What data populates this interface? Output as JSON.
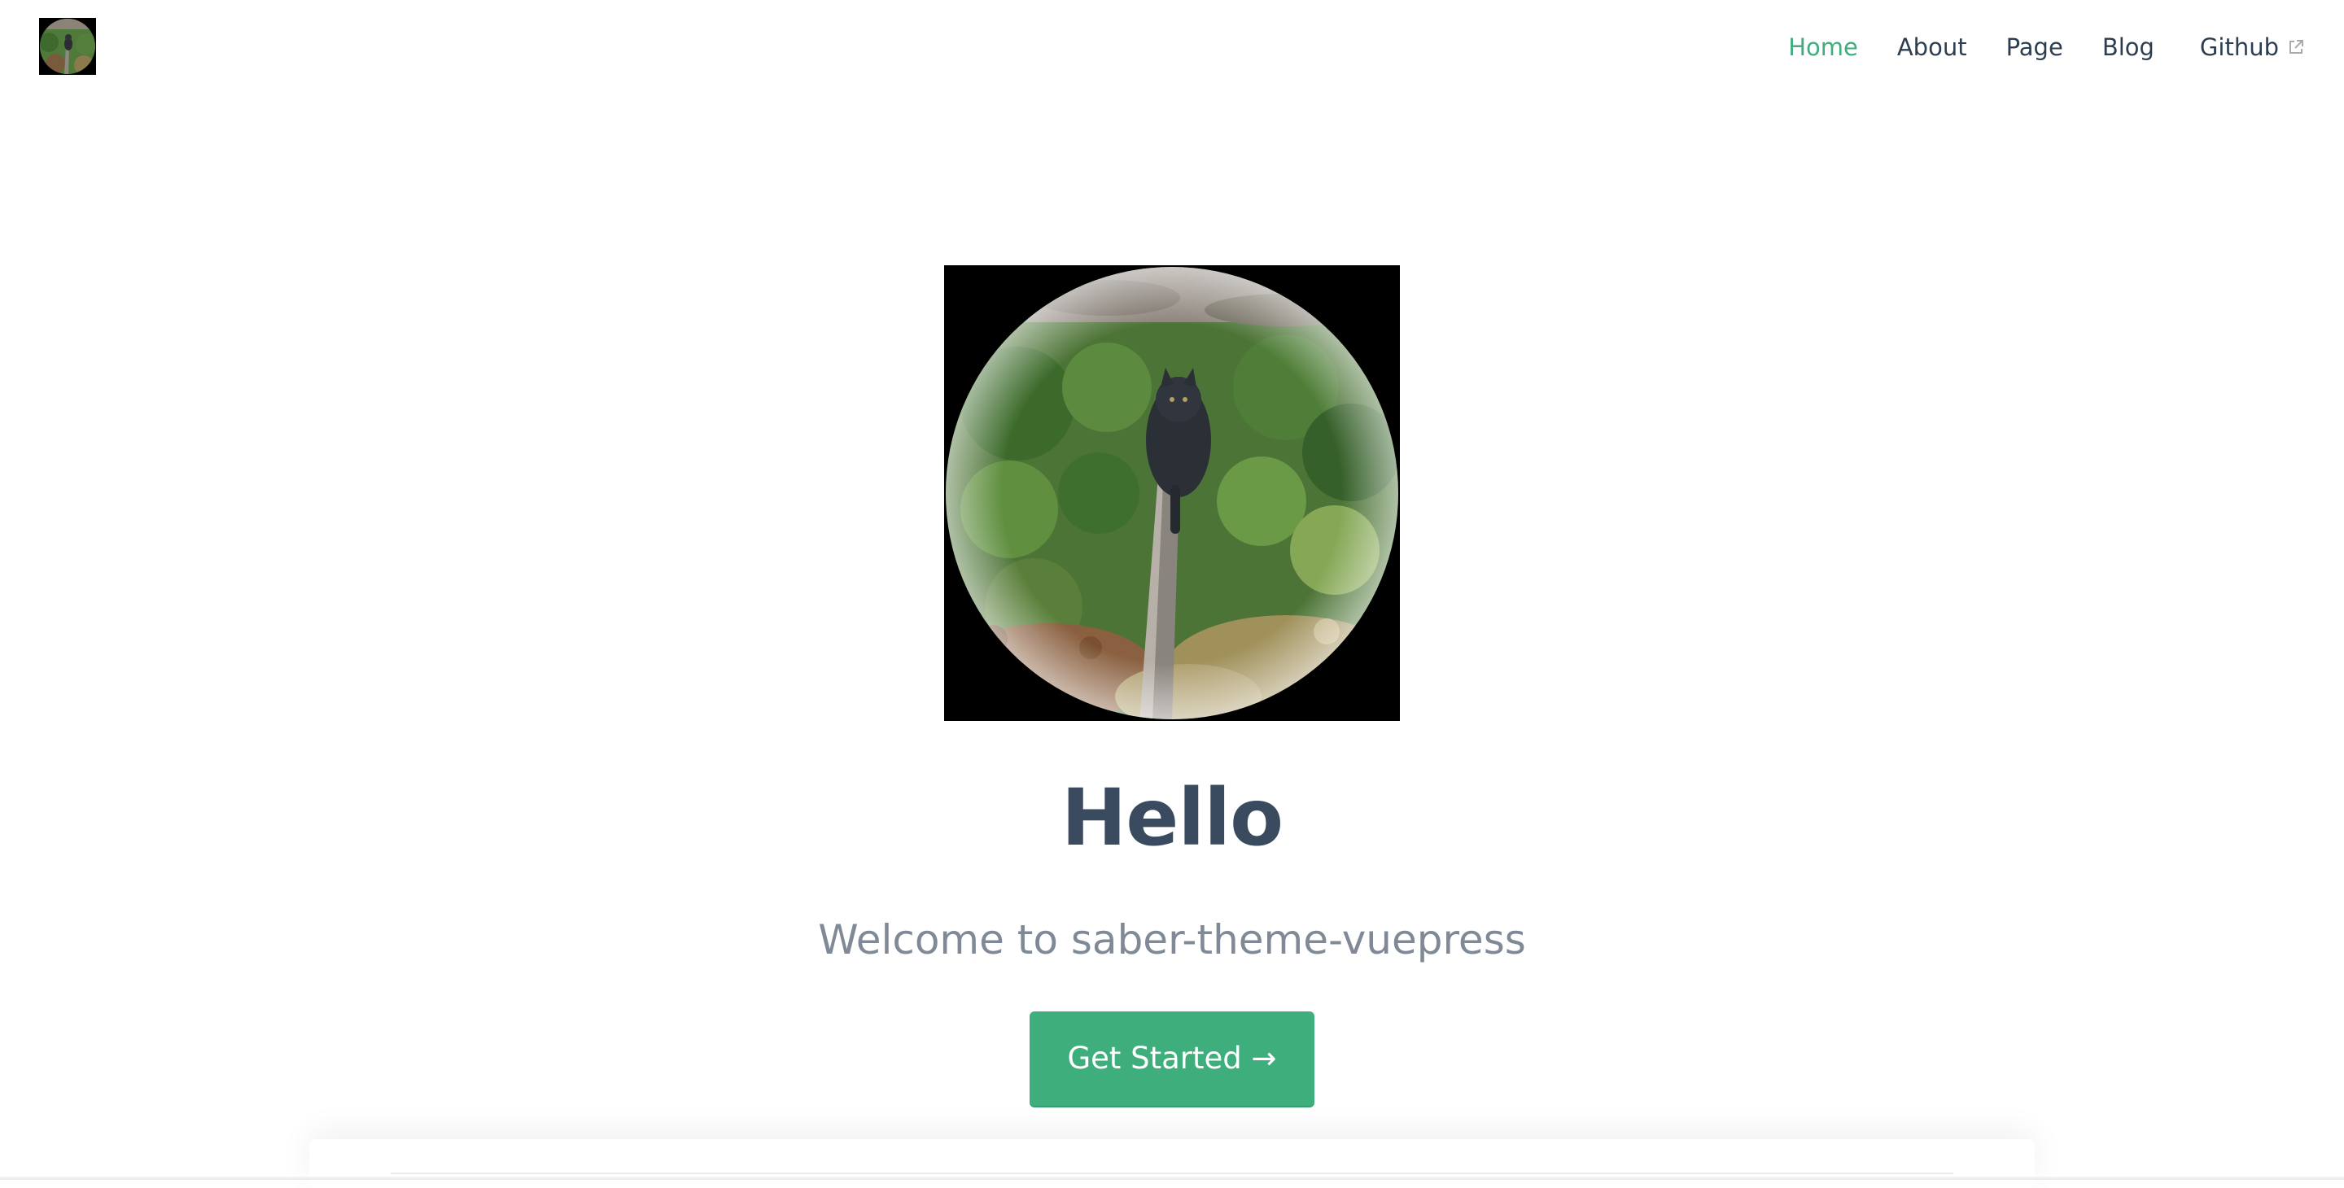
{
  "navbar": {
    "logo_alt": "site logo",
    "links": [
      {
        "label": "Home",
        "active": true
      },
      {
        "label": "About",
        "active": false
      },
      {
        "label": "Page",
        "active": false
      },
      {
        "label": "Blog",
        "active": false
      },
      {
        "label": "Github",
        "active": false,
        "external": true
      }
    ],
    "active_color": "#3eaf7c",
    "external_icon": "external-link-icon"
  },
  "hero": {
    "image_description_icon": "cat-on-rail-photo",
    "title": "Hello",
    "tagline": "Welcome to saber-theme-vuepress",
    "action": {
      "label": "Get Started →",
      "color": "#3eaf7c"
    }
  },
  "colors": {
    "accent": "#3eaf7c",
    "title": "#3a4a5f",
    "tagline": "#7f8a96",
    "nav_text": "#2c3e50"
  }
}
